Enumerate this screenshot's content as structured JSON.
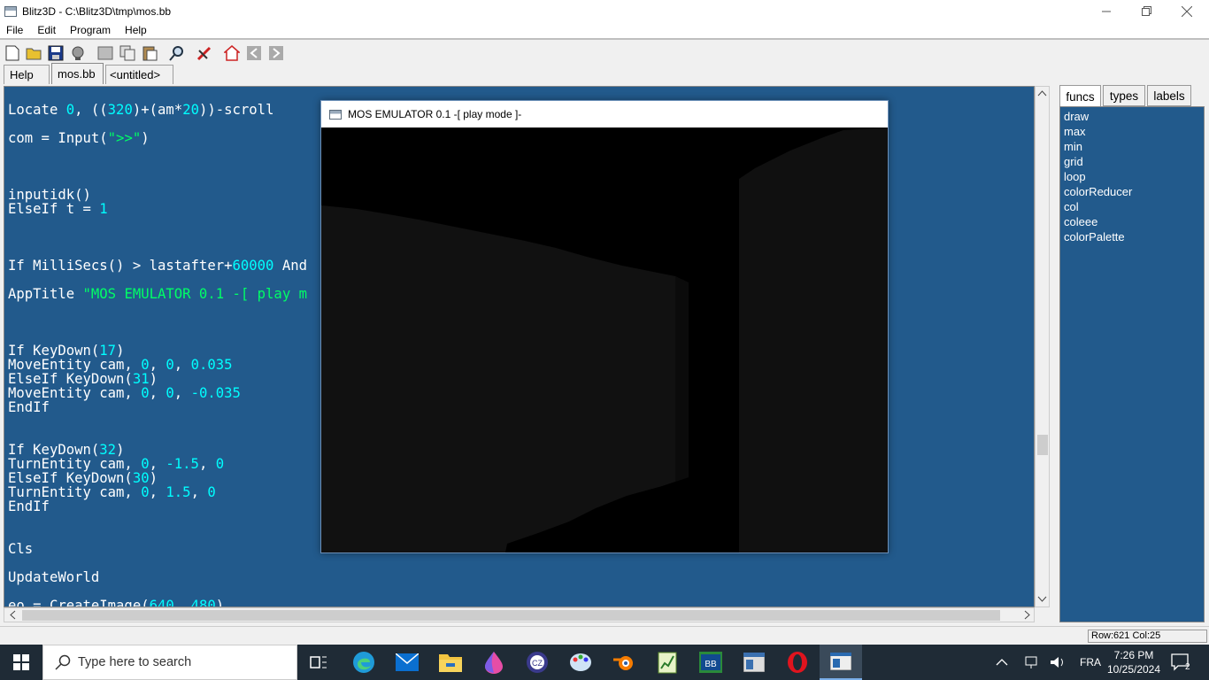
{
  "window": {
    "title": "Blitz3D - C:\\Blitz3D\\tmp\\mos.bb"
  },
  "menu": [
    "File",
    "Edit",
    "Program",
    "Help"
  ],
  "toolbar": [
    "new-icon",
    "open-icon",
    "save-icon",
    "idea-icon",
    "cut-icon",
    "copy-icon",
    "paste-icon",
    "find-icon",
    "run-icon",
    "home-icon",
    "back-icon",
    "forward-icon"
  ],
  "tabs": [
    "Help",
    "mos.bb",
    "<untitled>"
  ],
  "code": [
    {
      "t": "Locate 0, ((320)+(am*20))-scroll"
    },
    {
      "t": ""
    },
    {
      "t": "com = Input(\">>\")"
    },
    {
      "t": ""
    },
    {
      "t": ""
    },
    {
      "t": ""
    },
    {
      "t": "inputidk()"
    },
    {
      "t": "ElseIf t = 1"
    },
    {
      "t": ""
    },
    {
      "t": ""
    },
    {
      "t": ""
    },
    {
      "t": "If MilliSecs() > lastafter+60000 And"
    },
    {
      "t": ""
    },
    {
      "t": "AppTitle \"MOS EMULATOR 0.1 -[ play m"
    },
    {
      "t": ""
    },
    {
      "t": ""
    },
    {
      "t": ""
    },
    {
      "t": "If KeyDown(17)"
    },
    {
      "t": "MoveEntity cam, 0, 0, 0.035"
    },
    {
      "t": "ElseIf KeyDown(31)"
    },
    {
      "t": "MoveEntity cam, 0, 0, -0.035"
    },
    {
      "t": "EndIf"
    },
    {
      "t": ""
    },
    {
      "t": ""
    },
    {
      "t": "If KeyDown(32)"
    },
    {
      "t": "TurnEntity cam, 0, -1.5, 0"
    },
    {
      "t": "ElseIf KeyDown(30)"
    },
    {
      "t": "TurnEntity cam, 0, 1.5, 0"
    },
    {
      "t": "EndIf"
    },
    {
      "t": ""
    },
    {
      "t": ""
    },
    {
      "t": "Cls"
    },
    {
      "t": ""
    },
    {
      "t": "UpdateWorld"
    },
    {
      "t": ""
    },
    {
      "t": "eo = CreateImage(640, 480)"
    }
  ],
  "sidebar": {
    "tabs": [
      "funcs",
      "types",
      "labels"
    ],
    "items": [
      "draw",
      "max",
      "min",
      "grid",
      "loop",
      "colorReducer",
      "col",
      "coleee",
      "colorPalette"
    ]
  },
  "status": {
    "rowcol": "Row:621 Col:25"
  },
  "emulator": {
    "title": "MOS EMULATOR 0.1 -[ play mode ]-"
  },
  "taskbar": {
    "search_placeholder": "Type here to search",
    "lang": "FRA",
    "time": "7:26 PM",
    "date": "10/25/2024",
    "notifications": "2"
  }
}
